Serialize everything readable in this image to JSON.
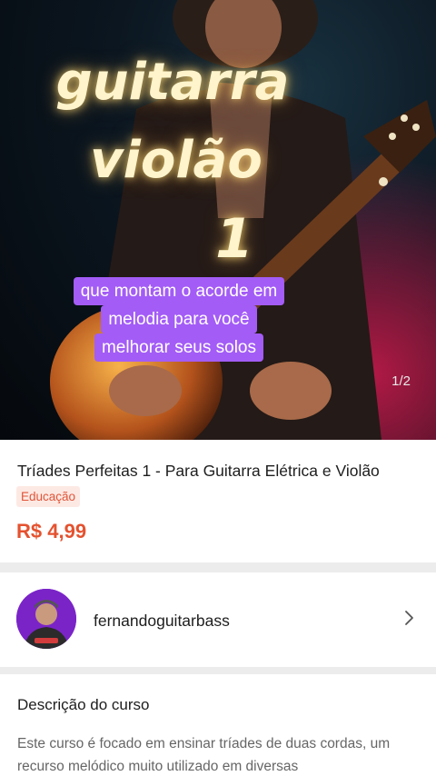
{
  "hero": {
    "title_line1": "guitarra",
    "title_line2": "violão",
    "title_line3": "1",
    "caption_lines": [
      "que montam o acorde em",
      "melodia para você",
      "melhorar seus solos"
    ],
    "counter": "1/2"
  },
  "product": {
    "title": "Tríades Perfeitas 1 - Para Guitarra Elétrica e Violão",
    "category": "Educação",
    "price": "R$ 4,99",
    "price_color": "#e4522f"
  },
  "seller": {
    "name": "fernandoguitarbass",
    "avatar_color": "#7a24c8"
  },
  "description": {
    "heading": "Descrição do curso",
    "text": "Este curso é focado em ensinar tríades de duas cordas, um recurso melódico muito utilizado em diversas"
  }
}
